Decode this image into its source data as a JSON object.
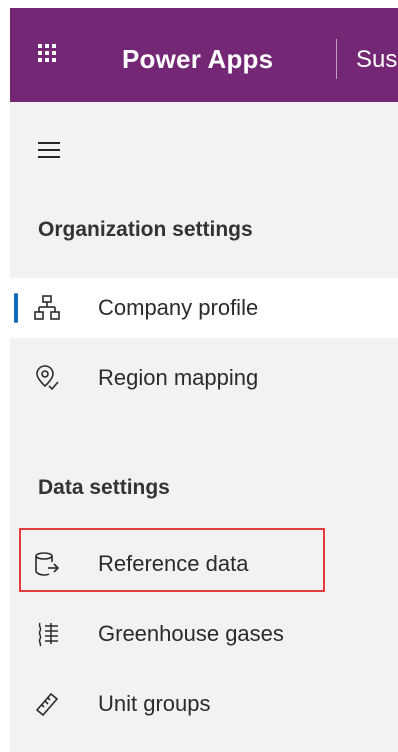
{
  "header": {
    "app_title": "Power Apps",
    "environment": "Sus",
    "background_color": "#742774",
    "waffle_icon": "waffle-icon"
  },
  "nav": {
    "menu_icon": "hamburger-icon",
    "groups": [
      {
        "heading": "Organization settings",
        "items": [
          {
            "label": "Company profile",
            "icon": "org-chart-icon",
            "selected": true
          },
          {
            "label": "Region mapping",
            "icon": "map-pin-icon",
            "selected": false
          }
        ]
      },
      {
        "heading": "Data settings",
        "items": [
          {
            "label": "Reference data",
            "icon": "database-arrow-icon",
            "selected": false,
            "highlighted": true
          },
          {
            "label": "Greenhouse gases",
            "icon": "gas-icon",
            "selected": false
          },
          {
            "label": "Unit groups",
            "icon": "ruler-icon",
            "selected": false
          }
        ]
      }
    ],
    "selected_indicator_color": "#0f6cbd",
    "highlight_color": "#e23b3b"
  }
}
